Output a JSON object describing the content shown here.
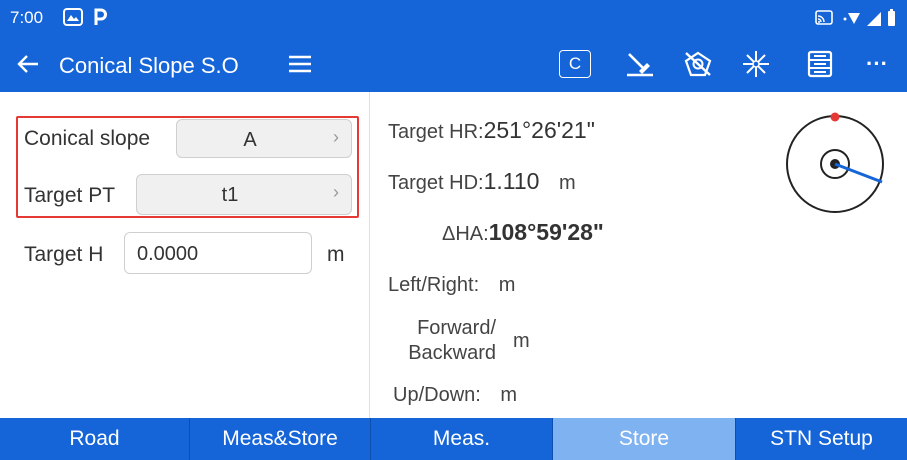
{
  "status_bar": {
    "time": "7:00",
    "icons": [
      "photos-icon",
      "parking-icon",
      "cast-icon",
      "wifi-icon",
      "signal-icon",
      "battery-icon"
    ]
  },
  "toolbar": {
    "title": "Conical Slope S.O",
    "back_icon": "back-arrow-icon",
    "menu_icon": "hamburger-menu-icon",
    "c_button_label": "C",
    "more_label": "···",
    "accent_color": "#1565d8"
  },
  "form": {
    "conical_slope": {
      "label": "Conical slope",
      "value": "A"
    },
    "target_pt": {
      "label": "Target PT",
      "value": "t1"
    },
    "target_h": {
      "label": "Target H",
      "value": "0.0000",
      "unit": "m"
    },
    "highlight_color": "#e53935"
  },
  "measurements": {
    "target_hr": {
      "label": "Target HR:",
      "value": "251°26'21\""
    },
    "target_hd": {
      "label": "Target HD:",
      "value": "1.110",
      "unit": "m"
    },
    "delta_ha": {
      "label": "ΔHA:",
      "value": "108°59'28\""
    },
    "left_right": {
      "label": "Left/Right:",
      "unit": "m"
    },
    "forward_backward": {
      "label_line1": "Forward/",
      "label_line2": "Backward",
      "unit": "m"
    },
    "up_down": {
      "label": "Up/Down:",
      "unit": "m"
    }
  },
  "compass": {
    "needle_color": "#1565d8",
    "marker_color": "#e53935"
  },
  "bottom_nav": {
    "items": [
      {
        "label": "Road",
        "active": false
      },
      {
        "label": "Meas&Store",
        "active": false
      },
      {
        "label": "Meas.",
        "active": false
      },
      {
        "label": "Store",
        "active": true
      },
      {
        "label": "STN Setup",
        "active": false
      }
    ]
  }
}
